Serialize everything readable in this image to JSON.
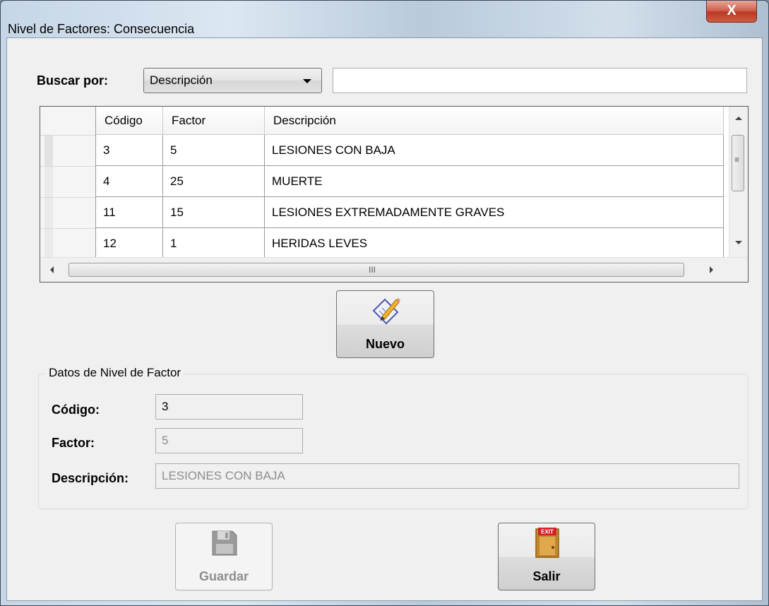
{
  "window": {
    "title": "Nivel de Factores: Consecuencia",
    "close_glyph": "X"
  },
  "search": {
    "label": "Buscar por:",
    "field_value": "Descripción",
    "query": "",
    "placeholder": ""
  },
  "grid": {
    "columns": [
      "Código",
      "Factor",
      "Descripción"
    ],
    "rows": [
      {
        "codigo": "3",
        "factor": "5",
        "descripcion": "LESIONES CON BAJA"
      },
      {
        "codigo": "4",
        "factor": "25",
        "descripcion": "MUERTE"
      },
      {
        "codigo": "11",
        "factor": "15",
        "descripcion": "LESIONES EXTREMADAMENTE GRAVES"
      },
      {
        "codigo": "12",
        "factor": "1",
        "descripcion": "HERIDAS LEVES"
      }
    ],
    "hscroll_grip": "III"
  },
  "buttons": {
    "nuevo": "Nuevo",
    "guardar": "Guardar",
    "salir": "Salir",
    "exit_sign": "EXIT"
  },
  "details": {
    "title": "Datos de Nivel de Factor",
    "codigo_label": "Código:",
    "codigo_value": "3",
    "factor_label": "Factor:",
    "factor_value": "5",
    "descripcion_label": "Descripción:",
    "descripcion_value": "LESIONES CON BAJA"
  },
  "icons": {
    "nuevo": "edit-pencil-icon",
    "guardar": "floppy-disk-icon",
    "salir": "exit-door-icon"
  },
  "colors": {
    "close_button": "#c94a32",
    "client_bg": "#f0f0f0",
    "exit_sign": "#d4202a"
  }
}
